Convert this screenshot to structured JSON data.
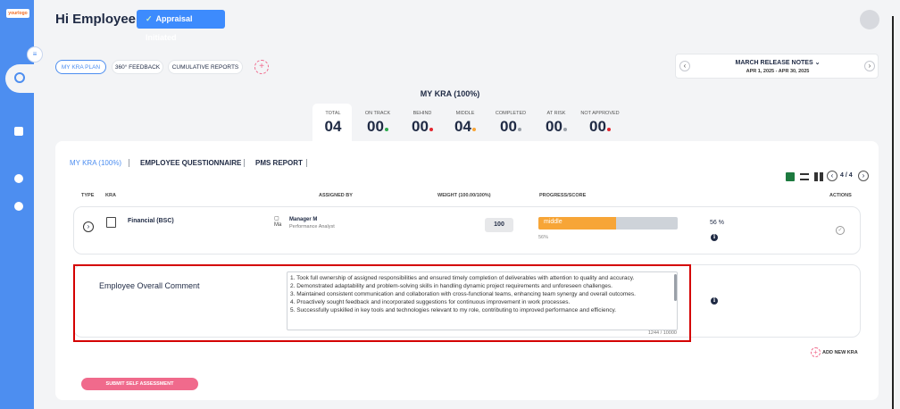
{
  "app": {
    "logo_text": "yourlogo"
  },
  "header": {
    "greeting": "Hi Employee E",
    "status_badge": "Appraisal Initiated"
  },
  "tabs": [
    {
      "label": "MY KRA PLAN",
      "active": true
    },
    {
      "label": "360° FEEDBACK",
      "active": false
    },
    {
      "label": "CUMULATIVE REPORTS",
      "active": false
    }
  ],
  "release": {
    "title": "MARCH RELEASE NOTES",
    "dates": "APR 1, 2025 - APR 30, 2025"
  },
  "kra_summary": {
    "title": "MY KRA (100%)",
    "stats": [
      {
        "label": "TOTAL",
        "value": "04",
        "dot": ""
      },
      {
        "label": "ON TRACK",
        "value": "00",
        "dot": "#2eaa4d"
      },
      {
        "label": "BEHIND",
        "value": "00",
        "dot": "#e3262f"
      },
      {
        "label": "MIDDLE",
        "value": "04",
        "dot": "#f7a537"
      },
      {
        "label": "COMPLETED",
        "value": "00",
        "dot": "#9aa0a8"
      },
      {
        "label": "AT RISK",
        "value": "00",
        "dot": "#9aa0a8"
      },
      {
        "label": "NOT APPROVED",
        "value": "00",
        "dot": "#e3262f"
      }
    ]
  },
  "subtabs": [
    {
      "label": "MY KRA (100%)",
      "active": true
    },
    {
      "label": "EMPLOYEE QUESTIONNAIRE",
      "active": false
    },
    {
      "label": "PMS REPORT",
      "active": false
    }
  ],
  "pagination": {
    "text": "4 / 4"
  },
  "table": {
    "headers": {
      "type": "TYPE",
      "kra": "KRA",
      "assigned_by": "ASSIGNED BY",
      "weight": "WEIGHT (100.00/100%)",
      "progress": "PROGRESS/SCORE",
      "actions": "ACTIONS"
    },
    "row": {
      "kra": "Financial (BSC)",
      "manager_img_alt": "Ma",
      "manager_name": "Manager M",
      "manager_role": "Performance Analyst",
      "weight": "100",
      "progress_label": "middle",
      "progress_pct_text": "56%",
      "progress_value": 0.56,
      "score": "56 %"
    }
  },
  "comment": {
    "label": "Employee Overall Comment",
    "lines": [
      "1. Took full ownership of assigned responsibilities and ensured timely completion of deliverables with attention to quality and accuracy.",
      "2. Demonstrated adaptability and problem-solving skills in handling dynamic project requirements and unforeseen challenges.",
      "3. Maintained consistent communication and collaboration with cross-functional teams, enhancing team synergy and overall outcomes.",
      "4. Proactively sought feedback and incorporated suggestions for continuous improvement in work processes.",
      "5. Successfully upskilled in key tools and technologies relevant to my role, contributing to improved performance and efficiency."
    ],
    "counter": "1244 / 10000"
  },
  "add_new_kra": "ADD NEW KRA",
  "submit": "SUBMIT SELF ASSESSMENT",
  "colors": {
    "accent": "#4d8ef0",
    "pink": "#f06a8c",
    "progress": "#f7a537",
    "highlight": "#d40000"
  }
}
